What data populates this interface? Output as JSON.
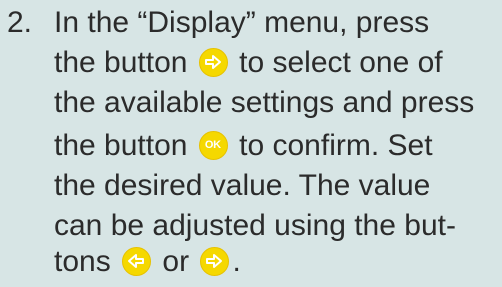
{
  "step": {
    "number": "2.",
    "line1": "In the “Display” menu, press",
    "line2_a": "the button",
    "line2_b": "to select one of",
    "line3": "the available settings and press",
    "line4_a": "the button",
    "line4_b": "to confirm. Set",
    "line5": "the desired value. The value",
    "line6": "can be adjusted using the but-",
    "line7_a": "tons",
    "line7_b": "or",
    "line7_c": "."
  },
  "icons": {
    "ok_label": "OK",
    "button_color": "#f5d800",
    "arrow_color": "#ffffff"
  }
}
